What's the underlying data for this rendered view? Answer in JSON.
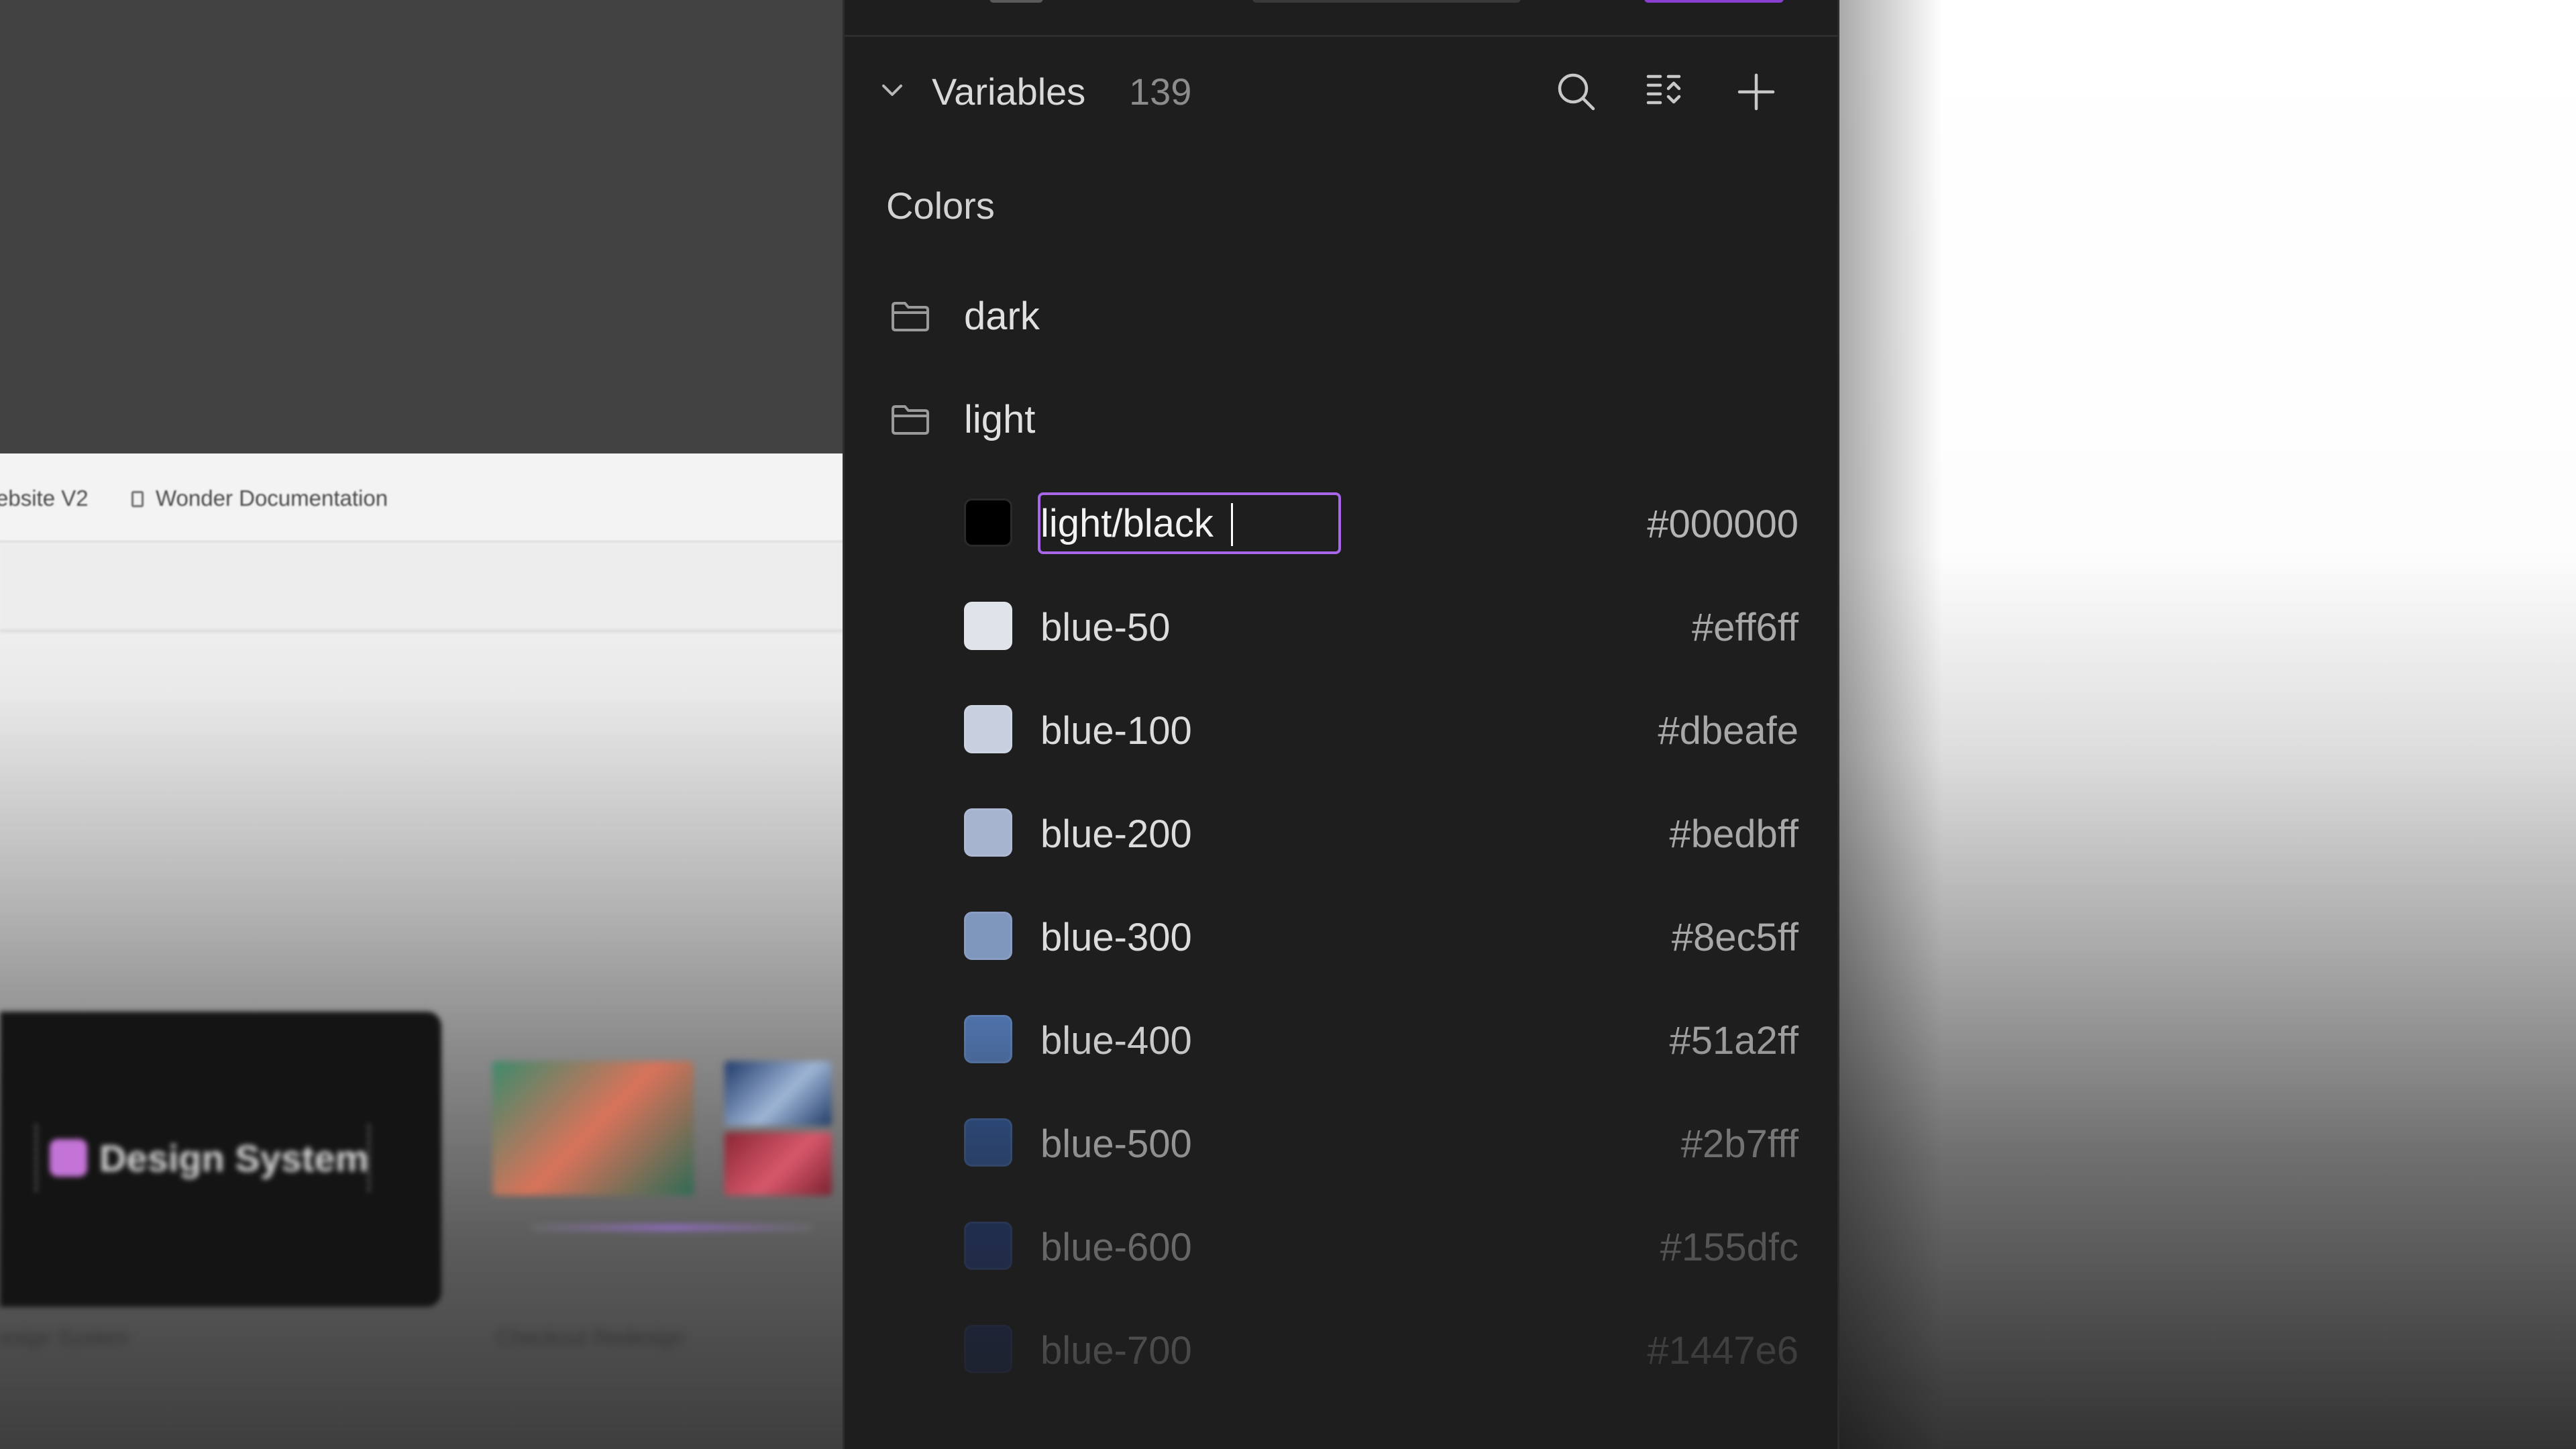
{
  "background_app": {
    "tabs": [
      {
        "label": "ebsite V2"
      },
      {
        "label": "Wonder Documentation"
      }
    ],
    "cards": [
      {
        "thumb_text": "Design System",
        "title": "esign System"
      },
      {
        "title": "Checkout Redesign"
      }
    ]
  },
  "variables_panel": {
    "title": "Variables",
    "count": "139",
    "icons": {
      "collapse": "chevron-down-icon",
      "search": "search-icon",
      "filter": "list-filter-icon",
      "add": "plus-icon"
    },
    "section": "Colors",
    "folders": [
      {
        "label": "dark",
        "icon": "folder-icon"
      },
      {
        "label": "light",
        "icon": "folder-icon"
      }
    ],
    "editing": {
      "value": "light/black",
      "swatch_color": "#000000",
      "hex": "#000000"
    },
    "variables": [
      {
        "name": "blue-50",
        "hex": "#eff6ff",
        "swatch_color": "#dfe3ea"
      },
      {
        "name": "blue-100",
        "hex": "#dbeafe",
        "swatch_color": "#c8d0df"
      },
      {
        "name": "blue-200",
        "hex": "#bedbff",
        "swatch_color": "#a6b4cf"
      },
      {
        "name": "blue-300",
        "hex": "#8ec5ff",
        "swatch_color": "#7f96bd"
      },
      {
        "name": "blue-400",
        "hex": "#51a2ff",
        "swatch_color": "#4f74ad"
      },
      {
        "name": "blue-500",
        "hex": "#2b7fff",
        "swatch_color": "#32599c"
      },
      {
        "name": "blue-600",
        "hex": "#155dfc",
        "swatch_color": "#24438f"
      },
      {
        "name": "blue-700",
        "hex": "#1447e6",
        "swatch_color": "#1f3478"
      }
    ],
    "colors": {
      "panel_bg": "#1e1e1e",
      "input_focus": "#a866e8"
    }
  }
}
